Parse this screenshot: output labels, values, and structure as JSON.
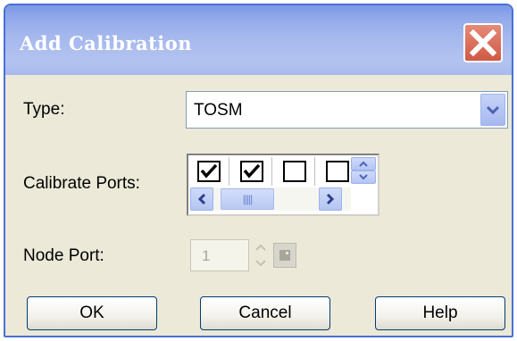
{
  "window": {
    "title": "Add Calibration"
  },
  "form": {
    "type": {
      "label": "Type:",
      "value": "TOSM"
    },
    "calibrate_ports": {
      "label": "Calibrate Ports:",
      "ports": [
        {
          "checked": true
        },
        {
          "checked": true
        },
        {
          "checked": false
        },
        {
          "checked": false
        }
      ]
    },
    "node_port": {
      "label": "Node Port:",
      "value": "1",
      "enabled": false
    }
  },
  "buttons": {
    "ok": "OK",
    "cancel": "Cancel",
    "help": "Help"
  },
  "icons": {
    "close": "close-icon",
    "dropdown": "chevron-down-icon",
    "spin_up": "arrow-up-icon",
    "spin_down": "arrow-down-icon",
    "scroll_left": "arrow-left-icon",
    "scroll_right": "arrow-right-icon",
    "browse": "browse-icon"
  },
  "colors": {
    "title_bar": "#a5b8ee",
    "close_button": "#d9634d",
    "dialog_bg": "#ece9d8",
    "button_border": "#003c74"
  }
}
